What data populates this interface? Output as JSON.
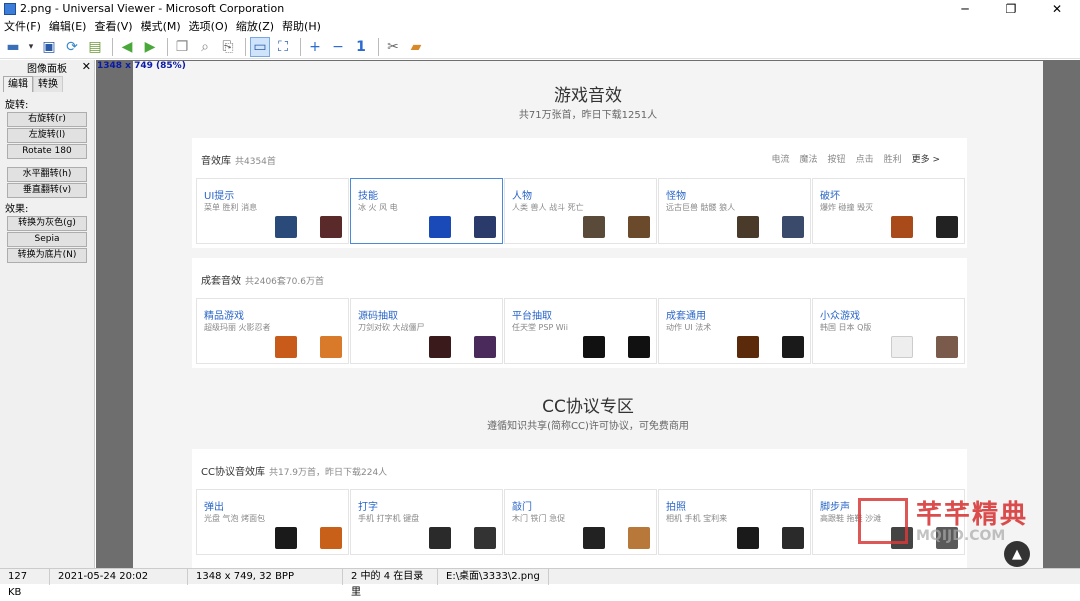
{
  "window": {
    "title": "2.png - Universal Viewer - Microsoft Corporation",
    "minimize": "─",
    "maximize": "❐",
    "close": "✕"
  },
  "menu": [
    "文件(F)",
    "编辑(E)",
    "查看(V)",
    "模式(M)",
    "选项(O)",
    "缩放(Z)",
    "帮助(H)"
  ],
  "toolbar": {
    "icons": [
      "open-icon",
      "dropdown-icon",
      "save-icon",
      "reload-icon",
      "delete-icon",
      "back-icon",
      "forward-icon",
      "copy-icon",
      "find-icon",
      "export-icon",
      "fit-window-icon",
      "fullscreen-icon",
      "zoom-in-icon",
      "zoom-out-icon",
      "actual-size-icon",
      "tools-icon",
      "plugin-icon"
    ]
  },
  "panel": {
    "title": "图像面板",
    "close": "✕",
    "tabs": [
      "编辑",
      "转换"
    ],
    "rotate_label": "旋转:",
    "rotate_buttons": [
      "右旋转(r)",
      "左旋转(l)",
      "Rotate 180"
    ],
    "flip_buttons": [
      "水平翻转(h)",
      "垂直翻转(v)"
    ],
    "effects_label": "效果:",
    "effect_buttons": [
      "转换为灰色(g)",
      "Sepia",
      "转换为底片(N)"
    ]
  },
  "zoom_label": "1348 x 749 (85%)",
  "content": {
    "sec1_title": "游戏音效",
    "sec1_sub": "共71万张首，昨日下载1251人",
    "lib1": {
      "title": "音效库",
      "count": "共4354首",
      "links": [
        "电流",
        "魔法",
        "按钮",
        "点击",
        "胜利"
      ],
      "more": "更多 >",
      "cards": [
        {
          "title": "UI提示",
          "desc": "菜单 胜利 消息"
        },
        {
          "title": "技能",
          "desc": "冰 火 风 电"
        },
        {
          "title": "人物",
          "desc": "人类 兽人 战斗 死亡"
        },
        {
          "title": "怪物",
          "desc": "远古巨兽 骷髅 狼人"
        },
        {
          "title": "破坏",
          "desc": "爆炸 碰撞 毁灭"
        }
      ]
    },
    "lib2": {
      "title": "成套音效",
      "count": "共2406套70.6万首",
      "cards": [
        {
          "title": "精品游戏",
          "desc": "超级玛丽 火影忍者"
        },
        {
          "title": "源码抽取",
          "desc": "刀剑对砍 大战僵尸"
        },
        {
          "title": "平台抽取",
          "desc": "任天堂 PSP Wii"
        },
        {
          "title": "成套通用",
          "desc": "动作 UI 法术"
        },
        {
          "title": "小众游戏",
          "desc": "韩国 日本 Q版"
        }
      ]
    },
    "sec2_title": "CC协议专区",
    "sec2_sub": "遵循知识共享(简称CC)许可协议，可免费商用",
    "lib3": {
      "title": "CC协议音效库",
      "count": "共17.9万首，昨日下载224人",
      "cards": [
        {
          "title": "弹出",
          "desc": "光盘 气泡 烤面包"
        },
        {
          "title": "打字",
          "desc": "手机 打字机 键盘"
        },
        {
          "title": "敲门",
          "desc": "木门 铁门 急促"
        },
        {
          "title": "拍照",
          "desc": "相机 手机 宝利来"
        },
        {
          "title": "脚步声",
          "desc": "高跟鞋 拖鞋 沙滩"
        }
      ]
    }
  },
  "watermark": {
    "text": "芊芊精典",
    "domain": "MQIJD.COM"
  },
  "status": [
    "127 KB",
    "2021-05-24 20:02",
    "1348 x 749, 32 BPP",
    "2 中的 4 在目录里",
    "E:\\桌面\\3333\\2.png"
  ],
  "colors": {
    "accent": "#2a66c8",
    "selected_border": "#4a8ad8",
    "canvas": "#6e6e6e"
  }
}
